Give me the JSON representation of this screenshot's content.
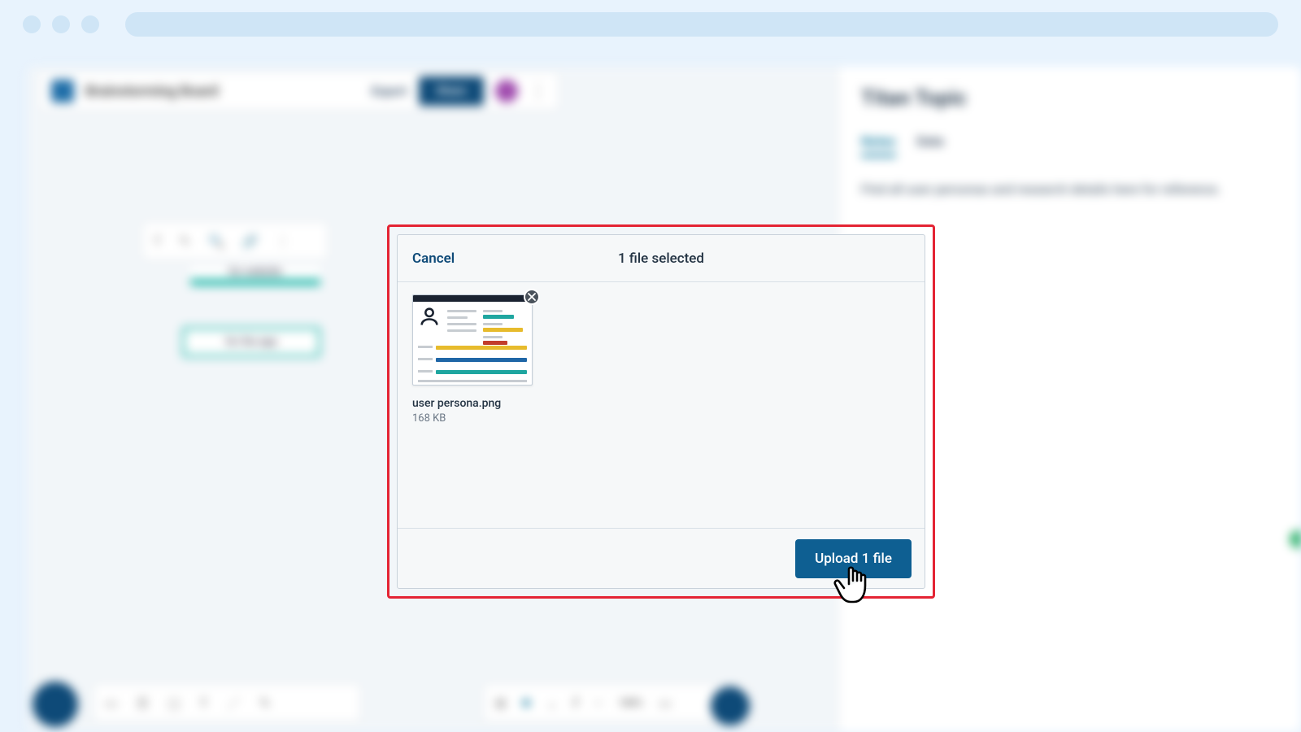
{
  "browser": {
    "dots": 3
  },
  "board": {
    "title": "Brainstorming Board",
    "export_label": "Export",
    "share_label": "Share",
    "node_a": "for website",
    "node_b": "for the app"
  },
  "panel": {
    "title": "Titan Topic",
    "tab_notes": "Notes",
    "tab_data": "Data",
    "body": "Find all user personas and research details here for reference."
  },
  "modal": {
    "cancel_label": "Cancel",
    "status_text": "1 file selected",
    "upload_label": "Upload 1 file",
    "file": {
      "name": "user persona.png",
      "size": "168 KB"
    }
  },
  "colors": {
    "accent": "#0e5f92",
    "highlight": "#e42434"
  }
}
